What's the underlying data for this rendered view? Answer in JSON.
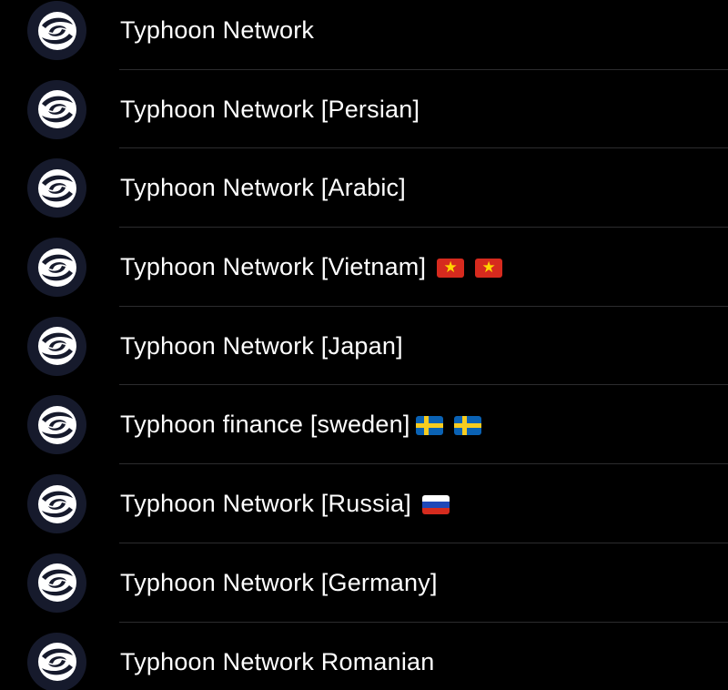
{
  "colors": {
    "background": "#000000",
    "text": "#ffffff",
    "divider": "#2c2c2e",
    "avatar_background": "#161a2c"
  },
  "channels": [
    {
      "name": "Typhoon Network",
      "icon": "typhoon-logo-icon",
      "flags": []
    },
    {
      "name": "Typhoon Network [Persian]",
      "icon": "typhoon-logo-icon",
      "flags": []
    },
    {
      "name": "Typhoon Network [Arabic]",
      "icon": "typhoon-logo-icon",
      "flags": []
    },
    {
      "name": "Typhoon Network [Vietnam]",
      "icon": "typhoon-logo-icon",
      "flags": [
        "vietnam-flag-icon",
        "vietnam-flag-icon"
      ]
    },
    {
      "name": "Typhoon Network [Japan]",
      "icon": "typhoon-logo-icon",
      "flags": []
    },
    {
      "name": "Typhoon finance [sweden]",
      "icon": "typhoon-logo-icon",
      "flags": [
        "sweden-flag-icon",
        "sweden-flag-icon"
      ]
    },
    {
      "name": "Typhoon Network [Russia]",
      "icon": "typhoon-logo-icon",
      "flags": [
        "russia-flag-icon"
      ]
    },
    {
      "name": "Typhoon Network [Germany]",
      "icon": "typhoon-logo-icon",
      "flags": []
    },
    {
      "name": "Typhoon Network Romanian",
      "icon": "typhoon-logo-icon",
      "flags": []
    }
  ]
}
